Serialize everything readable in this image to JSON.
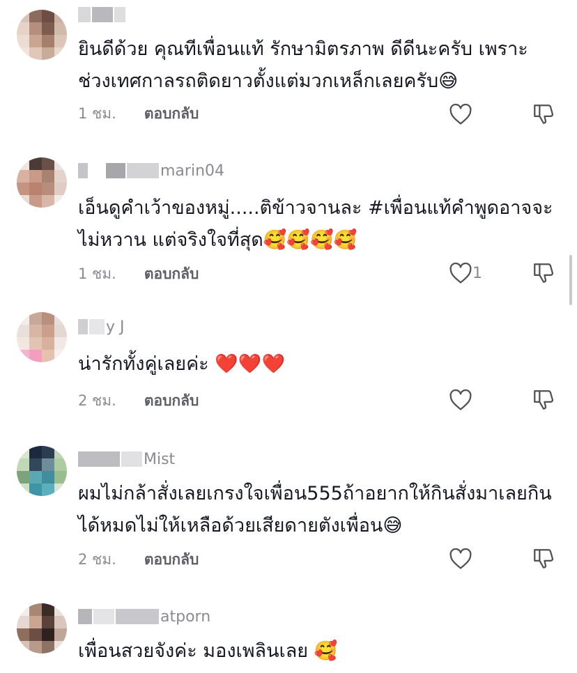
{
  "comments": [
    {
      "username": "",
      "text": "ยินดีด้วย คุณทีเพื่อนแท้ รักษามิตรภาพ ดีดีนะครับ เพราะช่วงเทศกาลรถติดยาวตั้งแต่มวกเหล็กเลยครับ😅",
      "time": "1 ชม.",
      "reply_label": "ตอบกลับ",
      "likes": ""
    },
    {
      "username": "marin04",
      "text": "เอ็นดูคำเว้าของหมู่.....ติข้าวจานละ #เพื่อนแท้คำพูดอาจจะไม่หวาน แต่จริงใจที่สุด🥰🥰🥰🥰",
      "time": "1 ชม.",
      "reply_label": "ตอบกลับ",
      "likes": "1"
    },
    {
      "username": "y J",
      "text": "น่ารักทั้งคู่เลยค่ะ ❤️❤️❤️",
      "time": "2 ชม.",
      "reply_label": "ตอบกลับ",
      "likes": ""
    },
    {
      "username": "Mist",
      "text": "ผมไม่กล้าสั่งเลยเกรงใจเพื่อน555ถ้าอยากให้กินสั่งมาเลยกินได้หมดไม่ให้เหลือด้วยเสียดายตังเพื่อน😅",
      "time": "2 ชม.",
      "reply_label": "ตอบกลับ",
      "likes": ""
    },
    {
      "username": "atporn",
      "text": "เพื่อนสวยจังค่ะ มองเพลินเลย 🥰",
      "time": "",
      "reply_label": "",
      "likes": ""
    }
  ],
  "icons": {
    "like": "heart-outline-icon",
    "dislike": "thumbs-down-outline-icon"
  },
  "colors": {
    "text": "#161823",
    "secondary": "#8a8b91",
    "reply": "#5d5e66"
  }
}
